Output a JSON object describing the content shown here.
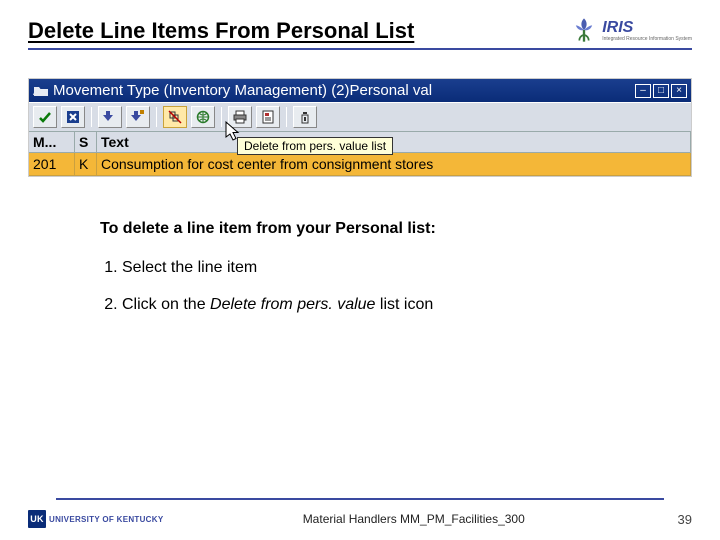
{
  "header": {
    "title": "Delete Line Items From Personal List",
    "brand": "IRIS",
    "brand_sub": "Integrated Resource Information System"
  },
  "sap": {
    "titlebar": {
      "text": "Movement Type (Inventory Management) (2)Personal val",
      "btn_min": "–",
      "btn_max": "□",
      "btn_close": "×"
    },
    "tooltip": "Delete from pers. value list",
    "columns": {
      "m": "M...",
      "s": "S",
      "t": "Text"
    },
    "row": {
      "m": "201",
      "s": "K",
      "t": "Consumption for cost center from consignment stores"
    }
  },
  "instructions": {
    "lead": "To delete a line item from your Personal list:",
    "step1_prefix": "Select the line item",
    "step2_a": "Click on the ",
    "step2_em": "Delete from pers. value",
    "step2_b": " list icon"
  },
  "footer": {
    "uk_badge": "UK",
    "uk_text": "UNIVERSITY OF KENTUCKY",
    "center": "Material Handlers MM_PM_Facilities_300",
    "page": "39"
  }
}
